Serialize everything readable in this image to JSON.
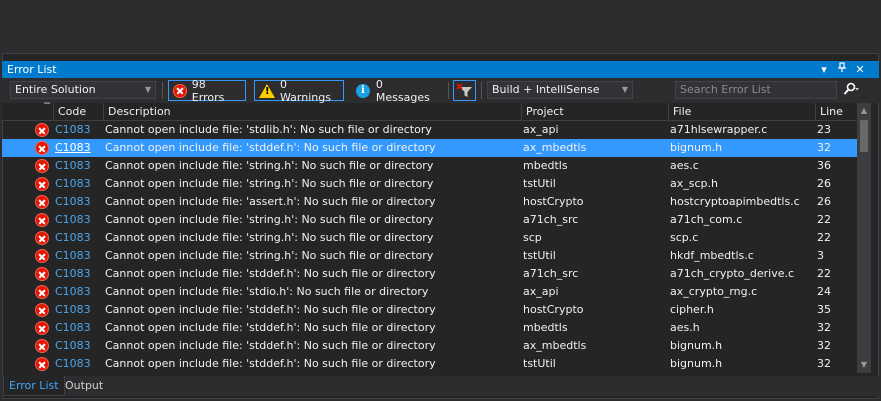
{
  "window": {
    "title": "Error List"
  },
  "toolbar": {
    "scope": "Entire Solution",
    "errors_label": "98 Errors",
    "warnings_label": "0 Warnings",
    "messages_label": "0 Messages",
    "build_filter": "Build + IntelliSense",
    "search_placeholder": "Search Error List"
  },
  "columns": {
    "code": "Code",
    "description": "Description",
    "project": "Project",
    "file": "File",
    "line": "Line"
  },
  "rows": [
    {
      "code": "C1083",
      "description": "Cannot open include file: 'stdlib.h': No such file or directory",
      "project": "ax_api",
      "file": "a71hlsewrapper.c",
      "line": "23"
    },
    {
      "code": "C1083",
      "description": "Cannot open include file: 'stddef.h': No such file or directory",
      "project": "ax_mbedtls",
      "file": "bignum.h",
      "line": "32",
      "selected": true
    },
    {
      "code": "C1083",
      "description": "Cannot open include file: 'string.h': No such file or directory",
      "project": "mbedtls",
      "file": "aes.c",
      "line": "36"
    },
    {
      "code": "C1083",
      "description": "Cannot open include file: 'string.h': No such file or directory",
      "project": "tstUtil",
      "file": "ax_scp.h",
      "line": "26"
    },
    {
      "code": "C1083",
      "description": "Cannot open include file: 'assert.h': No such file or directory",
      "project": "hostCrypto",
      "file": "hostcryptoapimbedtls.c",
      "line": "26"
    },
    {
      "code": "C1083",
      "description": "Cannot open include file: 'string.h': No such file or directory",
      "project": "a71ch_src",
      "file": "a71ch_com.c",
      "line": "22"
    },
    {
      "code": "C1083",
      "description": "Cannot open include file: 'string.h': No such file or directory",
      "project": "scp",
      "file": "scp.c",
      "line": "22"
    },
    {
      "code": "C1083",
      "description": "Cannot open include file: 'string.h': No such file or directory",
      "project": "tstUtil",
      "file": "hkdf_mbedtls.c",
      "line": "3"
    },
    {
      "code": "C1083",
      "description": "Cannot open include file: 'stddef.h': No such file or directory",
      "project": "a71ch_src",
      "file": "a71ch_crypto_derive.c",
      "line": "22"
    },
    {
      "code": "C1083",
      "description": "Cannot open include file: 'stdio.h': No such file or directory",
      "project": "ax_api",
      "file": "ax_crypto_rng.c",
      "line": "24"
    },
    {
      "code": "C1083",
      "description": "Cannot open include file: 'stddef.h': No such file or directory",
      "project": "hostCrypto",
      "file": "cipher.h",
      "line": "35"
    },
    {
      "code": "C1083",
      "description": "Cannot open include file: 'stddef.h': No such file or directory",
      "project": "mbedtls",
      "file": "aes.h",
      "line": "32"
    },
    {
      "code": "C1083",
      "description": "Cannot open include file: 'stddef.h': No such file or directory",
      "project": "ax_mbedtls",
      "file": "bignum.h",
      "line": "32"
    },
    {
      "code": "C1083",
      "description": "Cannot open include file: 'stddef.h': No such file or directory",
      "project": "tstUtil",
      "file": "bignum.h",
      "line": "32"
    }
  ],
  "bottom_tabs": [
    {
      "label": "Error List",
      "active": true
    },
    {
      "label": "Output",
      "active": false
    }
  ],
  "colors": {
    "accent": "#007acc",
    "selection": "#3399ff",
    "error_icon": "#e51400",
    "warning_icon": "#ffcc00",
    "info_icon": "#1ba1e2",
    "code_link": "#4ea6e8"
  },
  "icons": [
    "error-icon",
    "warning-icon",
    "info-icon",
    "filter-clear-icon",
    "search-icon",
    "dropdown-arrow-icon",
    "pin-icon",
    "close-icon"
  ]
}
